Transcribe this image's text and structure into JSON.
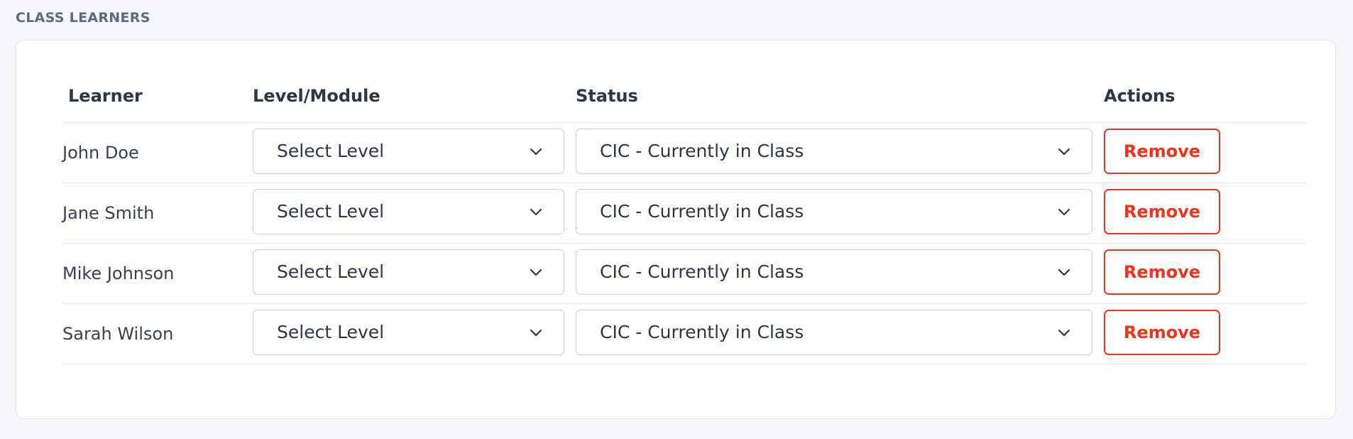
{
  "section": {
    "title": "CLASS LEARNERS"
  },
  "table": {
    "headers": {
      "learner": "Learner",
      "level": "Level/Module",
      "status": "Status",
      "actions": "Actions"
    },
    "rows": [
      {
        "name": "John Doe",
        "level": "Select Level",
        "status": "CIC - Currently in Class",
        "action": "Remove"
      },
      {
        "name": "Jane Smith",
        "level": "Select Level",
        "status": "CIC - Currently in Class",
        "action": "Remove"
      },
      {
        "name": "Mike Johnson",
        "level": "Select Level",
        "status": "CIC - Currently in Class",
        "action": "Remove"
      },
      {
        "name": "Sarah Wilson",
        "level": "Select Level",
        "status": "CIC - Currently in Class",
        "action": "Remove"
      }
    ]
  },
  "icons": {
    "dropdown": "chevron-down-icon"
  },
  "colors": {
    "danger": "#f0331b",
    "text": "#2f3447",
    "muted": "#5e6a85",
    "border": "#c8cdd9",
    "background": "#f5f7fb"
  }
}
